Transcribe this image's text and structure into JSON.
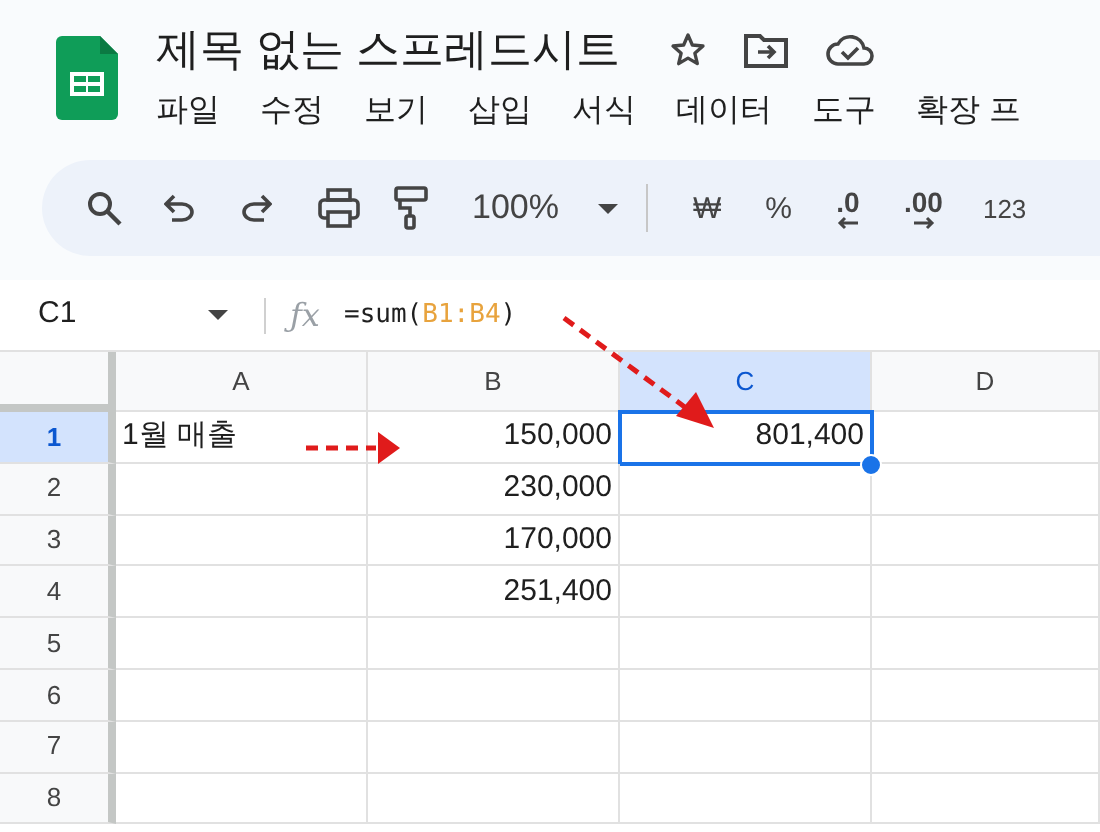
{
  "app": {
    "title": "제목 없는 스프레드시트",
    "menu": [
      "파일",
      "수정",
      "보기",
      "삽입",
      "서식",
      "데이터",
      "도구",
      "확장 프"
    ]
  },
  "toolbar": {
    "zoom": "100%",
    "format_items": [
      {
        "kind": "currency",
        "text": "₩"
      },
      {
        "kind": "percent",
        "text": "%"
      },
      {
        "kind": "decrease_decimal",
        "text": ".0"
      },
      {
        "kind": "increase_decimal",
        "text": ".00"
      },
      {
        "kind": "number_format",
        "text": "123"
      }
    ]
  },
  "formula_bar": {
    "cell_ref": "C1",
    "fx_label": "ƒx",
    "formula_start": "=sum(",
    "formula_range": "B1:B4",
    "formula_end": ")"
  },
  "grid": {
    "columns": [
      {
        "label": "A",
        "selected": false
      },
      {
        "label": "B",
        "selected": false
      },
      {
        "label": "C",
        "selected": true
      },
      {
        "label": "D",
        "selected": false
      }
    ],
    "rows": [
      {
        "label": "1",
        "selected": true,
        "cells": [
          {
            "kind": "text",
            "text": "1월 매출"
          },
          {
            "kind": "number",
            "text": "150,000"
          },
          {
            "kind": "number",
            "text": "801,400"
          },
          null
        ]
      },
      {
        "label": "2",
        "selected": false,
        "cells": [
          null,
          {
            "kind": "number",
            "text": "230,000"
          },
          null,
          null
        ]
      },
      {
        "label": "3",
        "selected": false,
        "cells": [
          null,
          {
            "kind": "number",
            "text": "170,000"
          },
          null,
          null
        ]
      },
      {
        "label": "4",
        "selected": false,
        "cells": [
          null,
          {
            "kind": "number",
            "text": "251,400"
          },
          null,
          null
        ]
      },
      {
        "label": "5",
        "selected": false,
        "cells": [
          null,
          null,
          null,
          null
        ]
      },
      {
        "label": "6",
        "selected": false,
        "cells": [
          null,
          null,
          null,
          null
        ]
      },
      {
        "label": "7",
        "selected": false,
        "cells": [
          null,
          null,
          null,
          null
        ]
      },
      {
        "label": "8",
        "selected": false,
        "cells": [
          null,
          null,
          null,
          null
        ]
      }
    ]
  }
}
